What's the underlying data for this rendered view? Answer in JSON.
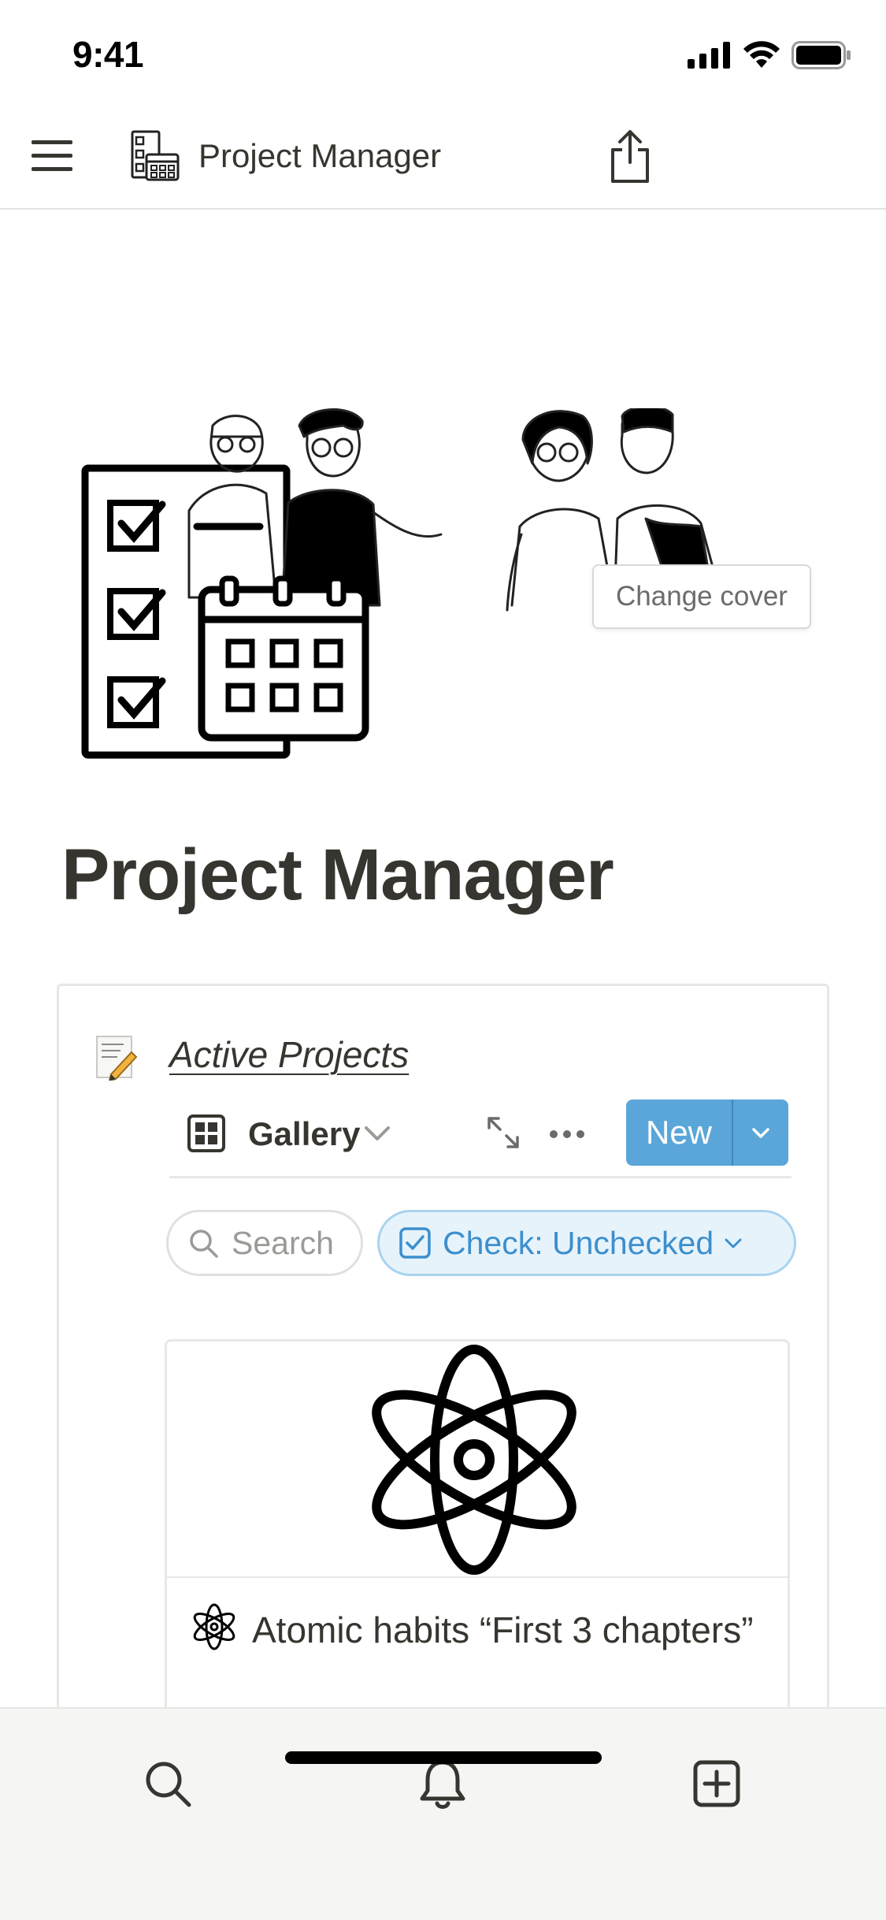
{
  "status_bar": {
    "time": "9:41"
  },
  "nav": {
    "title": "Project Manager",
    "menu_icon": "hamburger-icon",
    "share_icon": "share-icon"
  },
  "cover": {
    "change_cover_label": "Change cover"
  },
  "page": {
    "title": "Project Manager"
  },
  "database": {
    "icon": "memo-pencil-icon",
    "title": "Active Projects",
    "view": {
      "label": "Gallery"
    },
    "new_button": {
      "label": "New"
    },
    "search": {
      "label": "Search"
    },
    "filter": {
      "label": "Check: Unchecked"
    },
    "cards": [
      {
        "title": "Atomic habits “First 3 chapters”",
        "icon": "atom-icon"
      }
    ]
  },
  "bottom_bar": {
    "tabs": [
      {
        "name": "search",
        "icon": "search-icon"
      },
      {
        "name": "notifications",
        "icon": "bell-icon"
      },
      {
        "name": "new-page",
        "icon": "add-page-icon"
      }
    ]
  },
  "colors": {
    "accent": "#5aa6d9",
    "filter_text": "#3c8fcd",
    "filter_bg": "#e7f3fb",
    "text": "#37352f"
  }
}
